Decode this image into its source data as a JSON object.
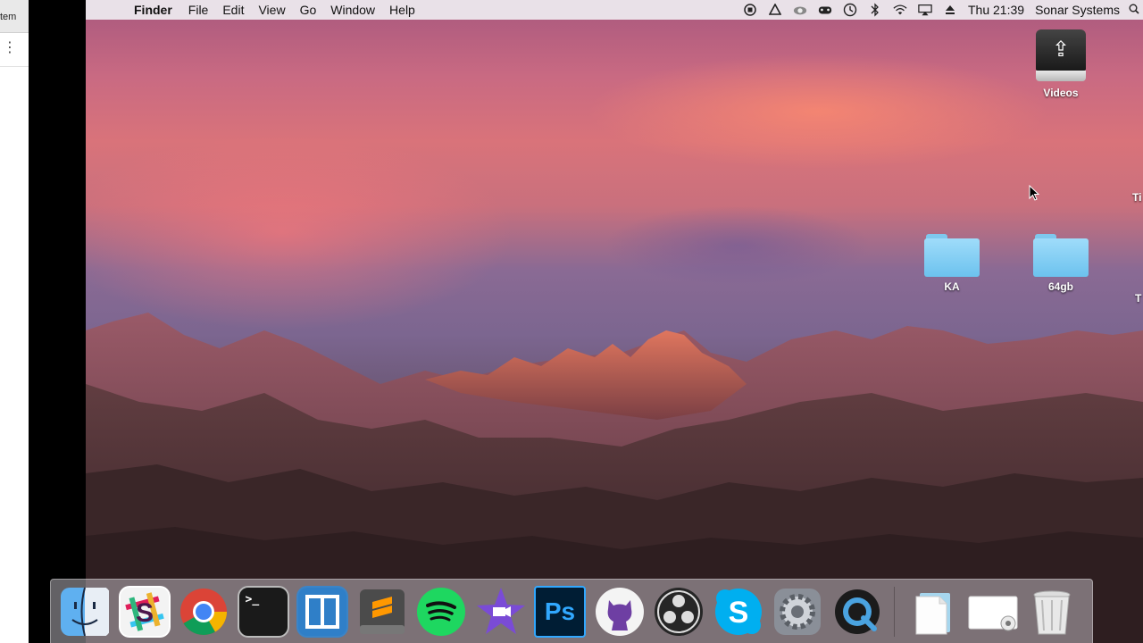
{
  "side_window": {
    "tab_text": "tem",
    "menu_dots": "⋮"
  },
  "menubar": {
    "apple_symbol": "",
    "app_name": "Finder",
    "menus": [
      "File",
      "Edit",
      "View",
      "Go",
      "Window",
      "Help"
    ],
    "clock": "Thu 21:39",
    "username": "Sonar Systems",
    "status_icons": [
      "record-icon",
      "drive-icon",
      "cloud-icon",
      "game-controller-icon",
      "time-machine-icon",
      "bluetooth-icon",
      "wifi-icon",
      "airplay-icon",
      "eject-icon",
      "spotlight-icon"
    ]
  },
  "desktop": {
    "icons": [
      {
        "name": "Videos",
        "kind": "usb-drive"
      },
      {
        "name": "KA",
        "kind": "folder"
      },
      {
        "name": "64gb",
        "kind": "folder"
      }
    ],
    "partial_labels": [
      "Ti",
      "T"
    ]
  },
  "dock": {
    "apps": [
      {
        "name": "Finder",
        "icon": "finder-icon"
      },
      {
        "name": "Slack",
        "icon": "slack-icon"
      },
      {
        "name": "Google Chrome",
        "icon": "chrome-icon"
      },
      {
        "name": "Terminal",
        "icon": "terminal-icon"
      },
      {
        "name": "Window Manager",
        "icon": "window-manager-icon"
      },
      {
        "name": "Sublime Text",
        "icon": "sublime-icon"
      },
      {
        "name": "Spotify",
        "icon": "spotify-icon"
      },
      {
        "name": "iMovie",
        "icon": "imovie-icon"
      },
      {
        "name": "Photoshop",
        "icon": "photoshop-icon"
      },
      {
        "name": "GitHub Desktop",
        "icon": "github-icon"
      },
      {
        "name": "OBS",
        "icon": "obs-icon"
      },
      {
        "name": "Skype",
        "icon": "skype-icon"
      },
      {
        "name": "System Preferences",
        "icon": "system-preferences-icon"
      },
      {
        "name": "QuickTime Player",
        "icon": "quicktime-icon"
      }
    ],
    "glyphs": {
      "slack": "S",
      "terminal": ">_",
      "photoshop": "Ps",
      "skype": "S"
    },
    "stacks": [
      {
        "name": "Documents",
        "icon": "documents-stack-icon"
      },
      {
        "name": "Downloads",
        "icon": "downloads-stack-icon"
      },
      {
        "name": "Trash",
        "icon": "trash-icon"
      }
    ]
  },
  "colors": {
    "folder": "#7ec8ee",
    "menubar": "#eeecf0",
    "photoshop": "#31a8ff",
    "spotify": "#1ed760",
    "skype": "#00aff0"
  }
}
